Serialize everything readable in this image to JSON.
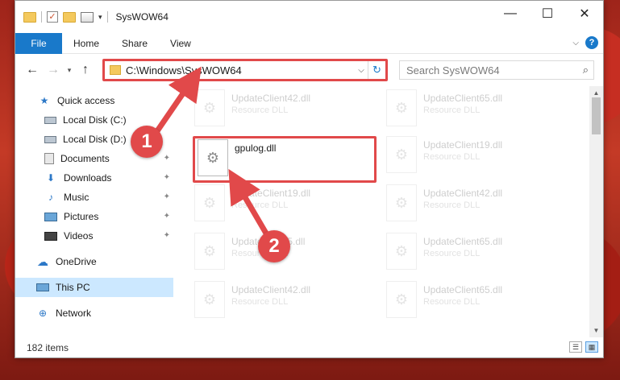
{
  "window": {
    "title": "SysWOW64",
    "controls": {
      "minimize": "—",
      "maximize": "☐",
      "close": "✕"
    }
  },
  "ribbon": {
    "file": "File",
    "tabs": [
      "Home",
      "Share",
      "View"
    ],
    "help": "?"
  },
  "nav": {
    "back": "←",
    "forward": "→",
    "recent": "▾",
    "up": "↑",
    "address": "C:\\Windows\\SysWOW64",
    "refresh": "↻",
    "search_placeholder": "Search SysWOW64",
    "search_icon": "⌕"
  },
  "sidebar": {
    "quick_access": "Quick access",
    "items": [
      {
        "label": "Local Disk (C:)",
        "icon": "drive-icon",
        "pinned": true
      },
      {
        "label": "Local Disk (D:)",
        "icon": "drive-icon",
        "pinned": true
      },
      {
        "label": "Documents",
        "icon": "documents-icon",
        "pinned": true
      },
      {
        "label": "Downloads",
        "icon": "downloads-icon",
        "pinned": true
      },
      {
        "label": "Music",
        "icon": "music-icon",
        "pinned": true
      },
      {
        "label": "Pictures",
        "icon": "pictures-icon",
        "pinned": true
      },
      {
        "label": "Videos",
        "icon": "videos-icon",
        "pinned": true
      }
    ],
    "onedrive": "OneDrive",
    "this_pc": "This PC",
    "network": "Network"
  },
  "files": {
    "highlighted": {
      "name": "gpulog.dll",
      "type": ""
    },
    "others": [
      {
        "name": "UpdateClient42.dll",
        "type": "Resource DLL"
      },
      {
        "name": "UpdateClient65.dll",
        "type": "Resource DLL"
      },
      {
        "name": "UpdateClient19.dll",
        "type": "Resource DLL"
      },
      {
        "name": "UpdateClient19.dll",
        "type": "Resource DLL"
      },
      {
        "name": "UpdateClient42.dll",
        "type": "Resource DLL"
      },
      {
        "name": "UpdateClient5.dll",
        "type": "Resource DLL"
      },
      {
        "name": "UpdateClient65.dll",
        "type": "Resource DLL"
      },
      {
        "name": "UpdateClient42.dll",
        "type": "Resource DLL"
      },
      {
        "name": "UpdateClient65.dll",
        "type": "Resource DLL"
      }
    ]
  },
  "status": {
    "count": "182 items"
  },
  "annotations": {
    "step1": "1",
    "step2": "2",
    "color": "#e1494a"
  }
}
